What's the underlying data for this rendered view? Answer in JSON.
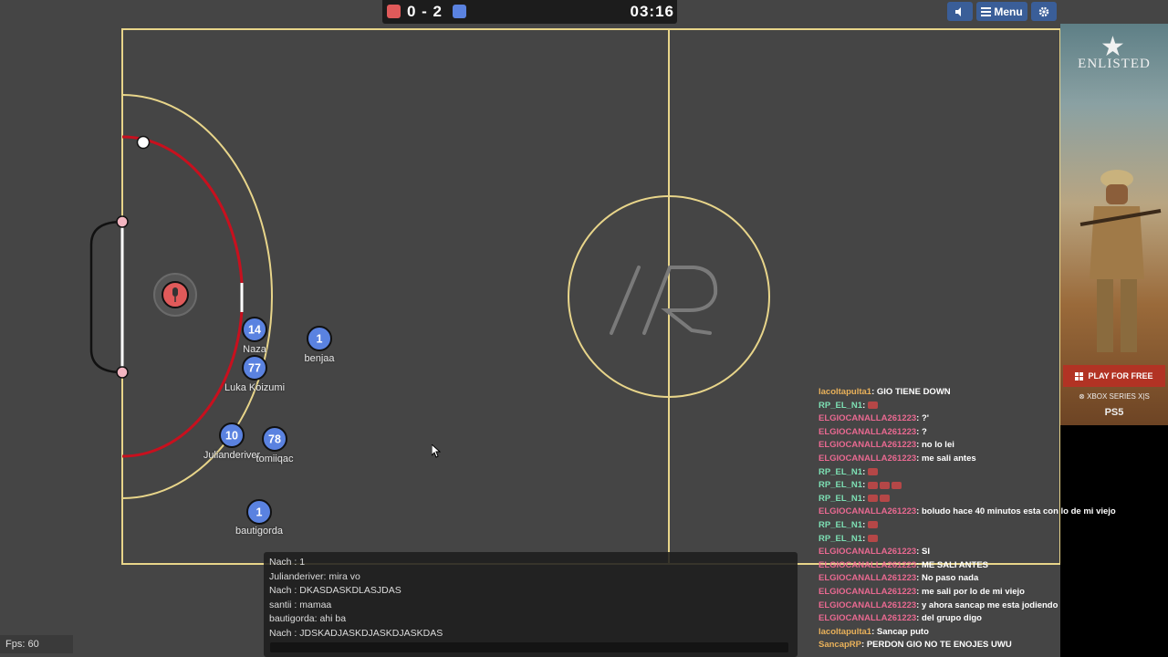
{
  "scoreboard": {
    "score": "0 - 2",
    "timer": "03:16",
    "red_color": "#e05a5a",
    "blue_color": "#5a82e0"
  },
  "top_buttons": {
    "sound_icon": "speaker-icon",
    "menu_label": "Menu",
    "settings_icon": "gear-icon"
  },
  "players": [
    {
      "number": "14",
      "name": "Naza",
      "team": "blue"
    },
    {
      "number": "1",
      "name": "benjaa",
      "team": "blue"
    },
    {
      "number": "77",
      "name": "Luka Koizumi",
      "team": "blue"
    },
    {
      "number": "10",
      "name": "Julianderiver",
      "team": "blue"
    },
    {
      "number": "78",
      "name": "tomiiqac",
      "team": "blue"
    },
    {
      "number": "1",
      "name": "bautigorda",
      "team": "blue"
    }
  ],
  "colors": {
    "pitch": "#454545",
    "lines": "#e8d58a",
    "red_arc": "#c8101e",
    "blue_player": "#5a82e0",
    "red_player": "#e05a5a"
  },
  "fps": "Fps: 60",
  "room_chat": {
    "lines": [
      "Nach : 1",
      "Julianderiver: mira vo",
      "Nach : DKASDASKDLASJDAS",
      "santii : mamaa",
      "bautigorda: ahi ba",
      "Nach : JDSKADJASKDJASKDJASKDAS"
    ],
    "input_value": ""
  },
  "feed": [
    {
      "name": "lacoltapulta1",
      "color": "orange",
      "text": "GIO TIENE DOWN"
    },
    {
      "name": "RP_EL_N1",
      "color": "teal",
      "text": "",
      "emotes": 1
    },
    {
      "name": "ELGIOCANALLA261223",
      "color": "pink",
      "text": "?'"
    },
    {
      "name": "ELGIOCANALLA261223",
      "color": "pink",
      "text": "?"
    },
    {
      "name": "ELGIOCANALLA261223",
      "color": "pink",
      "text": "no lo lei"
    },
    {
      "name": "ELGIOCANALLA261223",
      "color": "pink",
      "text": "me sali antes"
    },
    {
      "name": "RP_EL_N1",
      "color": "teal",
      "text": "",
      "emotes": 1
    },
    {
      "name": "RP_EL_N1",
      "color": "teal",
      "text": "",
      "emotes": 3
    },
    {
      "name": "RP_EL_N1",
      "color": "teal",
      "text": "",
      "emotes": 2
    },
    {
      "name": "ELGIOCANALLA261223",
      "color": "pink",
      "text": "boludo hace 40 minutos esta con lo de mi viejo"
    },
    {
      "name": "RP_EL_N1",
      "color": "teal",
      "text": "",
      "emotes": 1
    },
    {
      "name": "RP_EL_N1",
      "color": "teal",
      "text": "",
      "emotes": 1
    },
    {
      "name": "ELGIOCANALLA261223",
      "color": "pink",
      "text": "SI"
    },
    {
      "name": "ELGIOCANALLA261223",
      "color": "pink",
      "text": "ME SALI ANTES"
    },
    {
      "name": "ELGIOCANALLA261223",
      "color": "pink",
      "text": "No paso nada"
    },
    {
      "name": "ELGIOCANALLA261223",
      "color": "pink",
      "text": "me sali por lo de mi viejo"
    },
    {
      "name": "ELGIOCANALLA261223",
      "color": "pink",
      "text": "y ahora sancap me esta jodiendo"
    },
    {
      "name": "ELGIOCANALLA261223",
      "color": "pink",
      "text": "del grupo digo"
    },
    {
      "name": "lacoltapulta1",
      "color": "orange",
      "text": "Sancap puto"
    },
    {
      "name": "SancapRP",
      "color": "orange",
      "text": "PERDON GIO NO TE ENOJES UWU"
    }
  ],
  "ad": {
    "logo": "ENLISTED",
    "cta": "PLAY FOR FREE",
    "platform1": "XBOX SERIES X|S",
    "platform2": "PS5"
  }
}
